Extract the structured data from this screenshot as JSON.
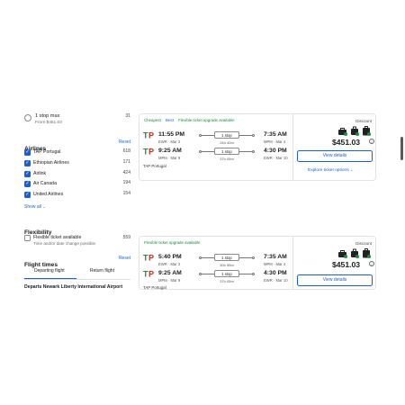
{
  "sidebar": {
    "stops": {
      "label": "1 stop max",
      "sublabel": "From $451.03",
      "count": "31"
    },
    "airlines": {
      "title": "Airlines",
      "reset": "Reset",
      "items": [
        {
          "label": "TAP Portugal",
          "count": "618"
        },
        {
          "label": "Ethiopian Airlines",
          "count": "171"
        },
        {
          "label": "Airlink",
          "count": "424"
        },
        {
          "label": "Air Canada",
          "count": "194"
        },
        {
          "label": "United Airlines",
          "count": "154"
        }
      ],
      "show_all": "Show all"
    },
    "flexibility": {
      "title": "Flexibility",
      "option_label": "Flexible ticket available",
      "option_sub": "Time and/or date change possible",
      "count": "559"
    },
    "flight_times": {
      "title": "Flight times",
      "reset": "Reset",
      "tabs": [
        "Departing flight",
        "Return flight"
      ],
      "departs_label": "Departs Newark Liberty International Airport"
    }
  },
  "cards": [
    {
      "badges": [
        "Cheapest",
        "Best",
        "Flexible ticket upgrade available"
      ],
      "legs": [
        {
          "dep_time": "11:55 PM",
          "dep_sub": "EWR · Mar 2",
          "stops": "1 stop",
          "duration": "24h 40m",
          "arr_time": "7:35 AM",
          "arr_sub": "MPM · Mar 4"
        },
        {
          "dep_time": "9:25 AM",
          "dep_sub": "MPM · Mar 9",
          "stops": "1 stop",
          "duration": "37h 05m",
          "arr_time": "4:30 PM",
          "arr_sub": "EWR · Mar 10"
        }
      ],
      "carrier": "TAP Portugal",
      "discount": "Discount",
      "price": "$451.03",
      "button": "View details",
      "explore": "Explore ticket options"
    },
    {
      "badges": [
        "Flexible ticket upgrade available"
      ],
      "legs": [
        {
          "dep_time": "5:40 PM",
          "dep_sub": "EWR · Mar 2",
          "stops": "1 stop",
          "duration": "30h 55m",
          "arr_time": "7:35 AM",
          "arr_sub": "MPM · Mar 4"
        },
        {
          "dep_time": "9:25 AM",
          "dep_sub": "MPM · Mar 9",
          "stops": "1 stop",
          "duration": "37h 05m",
          "arr_time": "4:30 PM",
          "arr_sub": "EWR · Mar 10"
        }
      ],
      "carrier": "TAP Portugal",
      "discount": "Discount",
      "price": "$451.03",
      "button": "View details"
    }
  ],
  "icons": {
    "airline_logo": "tap-portugal-logo-icon",
    "bags": [
      "personal-item-icon",
      "carry-on-bag-icon",
      "checked-bag-icon"
    ],
    "info": "info-icon",
    "chevron": "chevron-down-icon",
    "check": "checkmark-icon"
  },
  "colors": {
    "accent": "#1a5fd0",
    "badge_green": "#1a8a3c",
    "tap_green": "#1a8a3c",
    "tap_red": "#d52b1e"
  }
}
